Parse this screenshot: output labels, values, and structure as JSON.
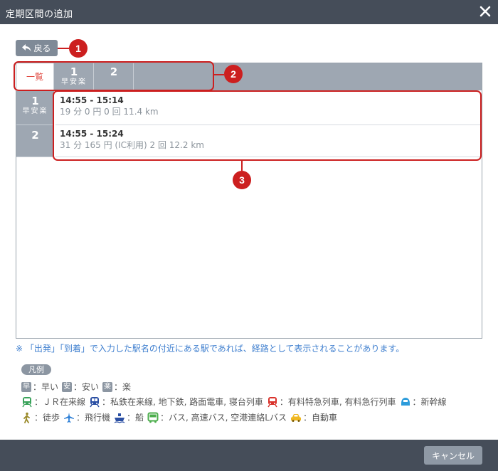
{
  "window": {
    "title": "定期区間の追加"
  },
  "back_label": "戻る",
  "callouts": [
    "1",
    "2",
    "3"
  ],
  "tabs": [
    {
      "label": "一覧"
    },
    {
      "num": "1",
      "sub": "早安楽"
    },
    {
      "num": "2",
      "sub": ""
    }
  ],
  "routes": [
    {
      "num": "1",
      "sub": "早安楽",
      "time": "14:55 - 15:14",
      "detail": "19 分 0 円  0 回 11.4 km"
    },
    {
      "num": "2",
      "sub": "",
      "time": "14:55 - 15:24",
      "detail": "31 分 165 円 (IC利用) 2 回 12.2 km"
    }
  ],
  "note": "※ 「出発」「到着」で入力した駅名の付近にある駅であれば、経路として表示されることがあります。",
  "legend": {
    "title": "凡例",
    "row1": [
      {
        "badge": "早",
        "text": "：早い"
      },
      {
        "badge": "安",
        "text": "：安い"
      },
      {
        "badge": "楽",
        "text": "：楽"
      }
    ],
    "row2": [
      {
        "icon": "jr-train-icon",
        "text": "：ＪＲ在来線"
      },
      {
        "icon": "private-railway-icon",
        "text": "：私鉄在来線, 地下鉄, 路面電車, 寝台列車"
      },
      {
        "icon": "limited-express-icon",
        "text": "：有料特急列車, 有料急行列車"
      },
      {
        "icon": "shinkansen-icon",
        "text": "：新幹線"
      }
    ],
    "row3": [
      {
        "icon": "walk-icon",
        "text": "：徒歩"
      },
      {
        "icon": "airplane-icon",
        "text": "：飛行機"
      },
      {
        "icon": "ship-icon",
        "text": "：船"
      },
      {
        "icon": "bus-icon",
        "text": "：バス, 高速バス, 空港連絡Lバス"
      },
      {
        "icon": "car-icon",
        "text": "：自動車"
      }
    ]
  },
  "colors": {
    "titlebar": "#454d59",
    "header": "#9ea7b2",
    "accent": "#cc1f1f",
    "note": "#3f7fcf"
  },
  "cancel_label": "キャンセル"
}
